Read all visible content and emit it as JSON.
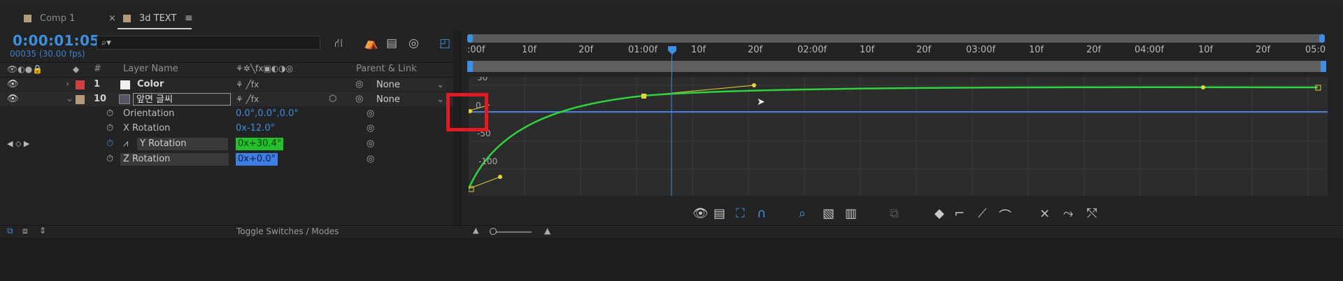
{
  "tabs": [
    {
      "label": "Comp 1",
      "color": "#b39a7a"
    },
    {
      "label": "3d TEXT",
      "color": "#b39a7a"
    }
  ],
  "tab_close": "×",
  "tab_menu": "≡",
  "timecode": "0:00:01:05",
  "fps": "00035 (30.00 fps)",
  "search_placeholder": "⌕▾",
  "columns": {
    "hash": "#",
    "layer_name": "Layer Name",
    "parent_link": "Parent & Link"
  },
  "layers": [
    {
      "number": "1",
      "name": "Color",
      "parent": "None",
      "label_color": "#d04040"
    },
    {
      "number": "10",
      "name": "앞면 글씨",
      "parent": "None",
      "label_color": "#b39a7a"
    }
  ],
  "properties": [
    {
      "name": "Orientation",
      "value": "0.0°,0.0°,0.0°"
    },
    {
      "name": "X Rotation",
      "value": "0x-12.0°"
    },
    {
      "name": "Y Rotation",
      "value": "0x+30.4°"
    },
    {
      "name": "Z Rotation",
      "value": "0x+0.0°"
    }
  ],
  "toggle_label": "Toggle Switches / Modes",
  "ruler_ticks": [
    ":00f",
    "10f",
    "20f",
    "01:00f",
    "10f",
    "20f",
    "02:00f",
    "10f",
    "20f",
    "03:00f",
    "10f",
    "20f",
    "04:00f",
    "10f",
    "20f",
    "05:0"
  ],
  "graph_labels": [
    "50",
    "0",
    "-50",
    "-100"
  ],
  "colors": {
    "accent_blue": "#3d8fe0",
    "curve_green": "#2fd33d",
    "handle_yellow": "#e8d23a",
    "highlight_red": "#e11a24"
  }
}
